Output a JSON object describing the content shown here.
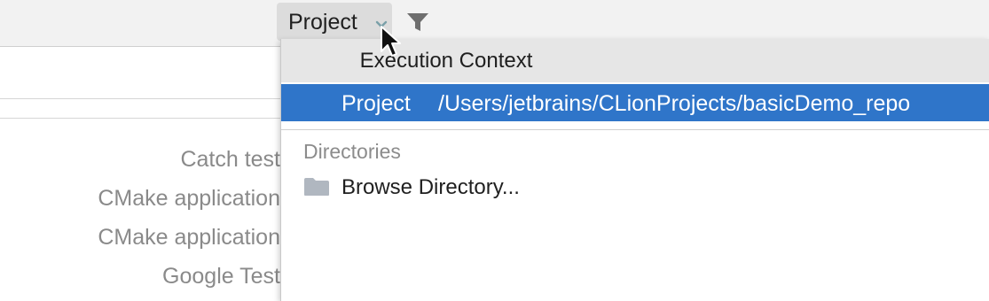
{
  "toolbar": {
    "scope_label": "Project",
    "chevron_icon": "chevron-down-icon",
    "filter_icon": "filter-icon"
  },
  "background_panel": {
    "items": [
      "Catch test",
      "CMake application",
      "CMake application",
      "Google Test"
    ]
  },
  "popup": {
    "title": "Execution Context",
    "selected": {
      "name": "Project",
      "path": "/Users/jetbrains/CLionProjects/basicDemo_repo"
    },
    "section_label": "Directories",
    "browse_label": "Browse Directory...",
    "folder_icon": "folder-icon"
  },
  "colors": {
    "selection": "#2f75c9",
    "header_bg": "#e6e6e6",
    "toolbar_bg": "#f2f2f2"
  }
}
